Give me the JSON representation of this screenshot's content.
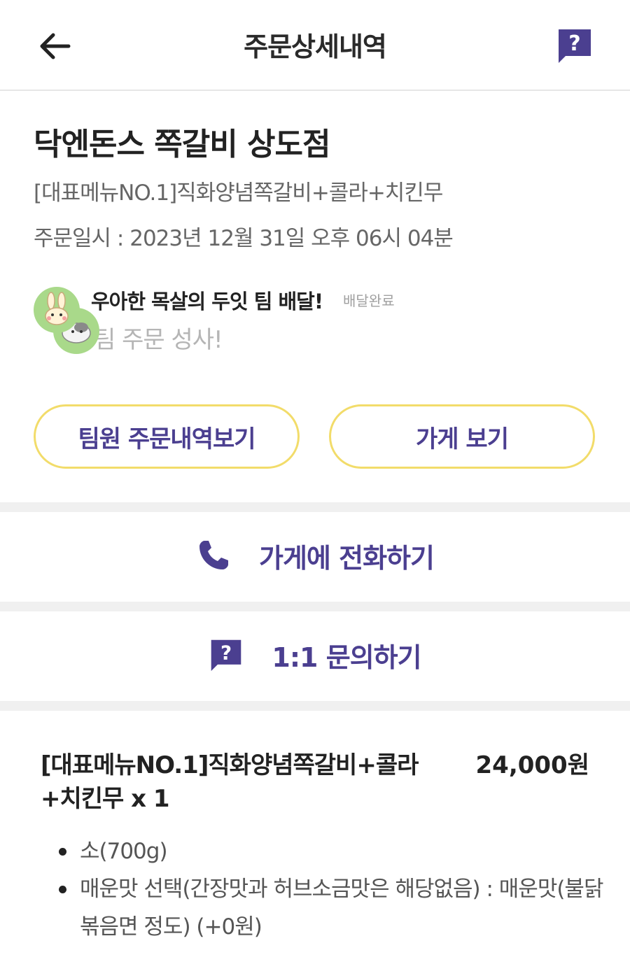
{
  "header": {
    "title": "주문상세내역",
    "back_icon": "arrow-left-icon",
    "help_icon": "question-bubble-icon"
  },
  "order": {
    "store_name": "닥엔돈스 쪽갈비 상도점",
    "menu_summary": "[대표메뉴NO.1]직화양념쪽갈비+콜라+치킨무",
    "date_label": "주문일시 : 2023년 12월 31일 오후 06시 04분"
  },
  "team": {
    "name": "우아한 목살의 두잇 팀 배달!",
    "status": "배달완료",
    "message": "팀 주문 성사!"
  },
  "buttons": {
    "team_orders": "팀원 주문내역보기",
    "view_store": "가게 보기"
  },
  "actions": {
    "call_store": "가게에 전화하기",
    "inquiry": "1:1 문의하기"
  },
  "item": {
    "name_line1": "[대표메뉴NO.1]직화양념쪽갈비+콜라",
    "name_line2": "+치킨무 x 1",
    "price": "24,000원",
    "options": [
      {
        "line1": "소(700g)",
        "line2": ""
      },
      {
        "line1": "매운맛 선택(간장맛과 허브소금맛은 해당없음) : 매운맛(불닭",
        "line2": "볶음면 정도) (+0원)"
      }
    ]
  },
  "colors": {
    "accent": "#4b3f90",
    "pill_border": "#f2dc6a",
    "avatar_bg": "#a9d98a",
    "divider": "#f0f0f0"
  }
}
